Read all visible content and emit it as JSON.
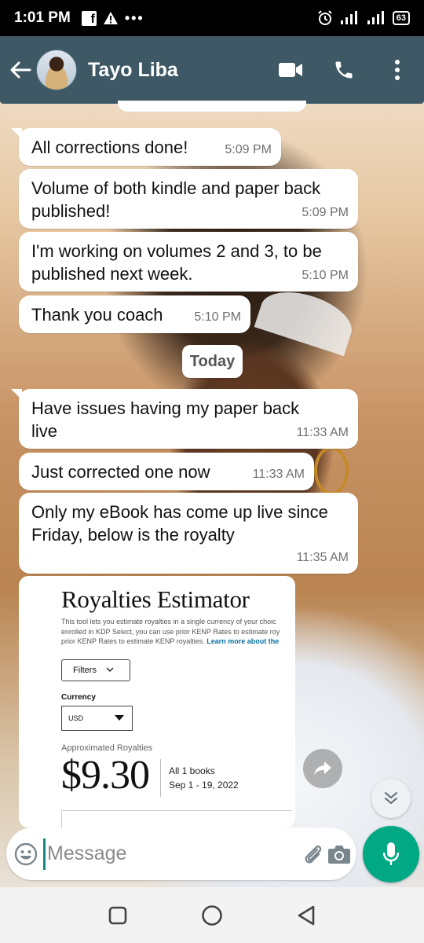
{
  "status_bar": {
    "time": "1:01 PM",
    "battery": "63"
  },
  "header": {
    "contact_name": "Tayo Liba"
  },
  "messages": [
    {
      "text": "All corrections done!",
      "time": "5:09 PM"
    },
    {
      "text": "Volume of both kindle and paper back published!",
      "time": "5:09 PM"
    },
    {
      "text": "I'm working on volumes 2 and 3, to be published next week.",
      "time": "5:10 PM"
    },
    {
      "text": "Thank you coach",
      "time": "5:10 PM"
    },
    {
      "text": "Have issues having my paper back live",
      "time": "11:33 AM"
    },
    {
      "text": "Just corrected one now",
      "time": "11:33 AM"
    },
    {
      "text": "Only my eBook has come up live since Friday, below is the royalty",
      "time": "11:35 AM"
    }
  ],
  "day_separator": "Today",
  "image_message": {
    "title": "Royalties Estimator",
    "desc_line1": "This tool lets you estimate royalties in a single currency of your choic",
    "desc_line2": "enrolled in KDP Select, you can use prior KENP Rates to estimate roy",
    "desc_line3": "prior KENP Rates to estimate KENP royalties.",
    "learn_more": "Learn more about the",
    "filters_label": "Filters",
    "currency_label": "Currency",
    "currency_value": "USD",
    "approx_label": "Approximated Royalties",
    "amount": "$9.30",
    "books": "All 1 books",
    "date_range": "Sep 1 - 19, 2022"
  },
  "composer": {
    "placeholder": "Message"
  },
  "colors": {
    "header": "#3e5866",
    "accent": "#00a884",
    "bubble": "#ffffff"
  }
}
